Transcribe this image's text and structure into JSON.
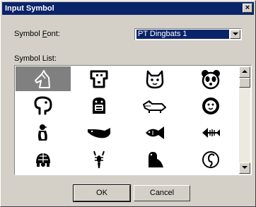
{
  "window": {
    "title": "Input Symbol",
    "close_glyph": "×"
  },
  "font_field": {
    "label_pre": "Symbol ",
    "label_accel": "F",
    "label_post": "ont:",
    "value": "PT Dingbats 1"
  },
  "list_label": "Symbol List:",
  "symbols": [
    {
      "name": "horse-head-icon",
      "selected": true
    },
    {
      "name": "dog-icon",
      "selected": false
    },
    {
      "name": "cat-face-icon",
      "selected": false
    },
    {
      "name": "panda-face-icon",
      "selected": false
    },
    {
      "name": "elephant-icon",
      "selected": false
    },
    {
      "name": "gorilla-face-icon",
      "selected": false
    },
    {
      "name": "alligator-icon",
      "selected": false
    },
    {
      "name": "lion-face-icon",
      "selected": false
    },
    {
      "name": "penguin-icon",
      "selected": false
    },
    {
      "name": "whale-icon",
      "selected": false
    },
    {
      "name": "fish-icon",
      "selected": false
    },
    {
      "name": "fish-skeleton-icon",
      "selected": false
    },
    {
      "name": "turtle-icon",
      "selected": false
    },
    {
      "name": "lobster-icon",
      "selected": false
    },
    {
      "name": "dinosaur-icon",
      "selected": false
    },
    {
      "name": "seahorse-icon",
      "selected": false
    }
  ],
  "buttons": {
    "ok": "OK",
    "cancel": "Cancel"
  }
}
